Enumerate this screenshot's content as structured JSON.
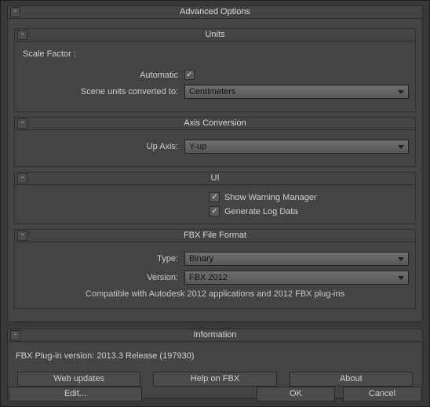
{
  "advanced": {
    "title": "Advanced Options",
    "collapse": "-",
    "units": {
      "title": "Units",
      "collapse": "-",
      "scale_factor_label": "Scale Factor :",
      "automatic_label": "Automatic",
      "automatic_checked": true,
      "converted_label": "Scene units converted to:",
      "converted_value": "Centimeters"
    },
    "axis": {
      "title": "Axis Conversion",
      "collapse": "-",
      "up_axis_label": "Up Axis:",
      "up_axis_value": "Y-up"
    },
    "ui": {
      "title": "UI",
      "collapse": "-",
      "warning_label": "Show Warning Manager",
      "warning_checked": true,
      "log_label": "Generate Log Data",
      "log_checked": true
    },
    "fbx": {
      "title": "FBX File Format",
      "collapse": "-",
      "type_label": "Type:",
      "type_value": "Binary",
      "version_label": "Version:",
      "version_value": "FBX 2012",
      "compat_note": "Compatible with Autodesk 2012 applications and 2012 FBX plug-ins"
    }
  },
  "info": {
    "title": "Information",
    "collapse": "-",
    "plugin_version": "FBX Plug-in version: 2013.3 Release (197930)",
    "web_updates": "Web updates",
    "help_fbx": "Help on FBX",
    "about": "About"
  },
  "buttons": {
    "edit": "Edit...",
    "ok": "OK",
    "cancel": "Cancel"
  }
}
